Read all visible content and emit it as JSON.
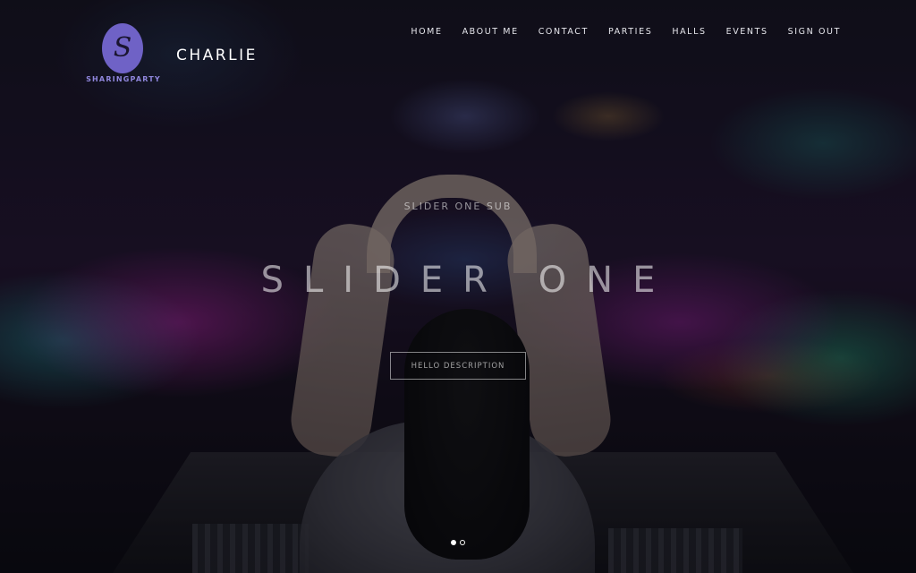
{
  "header": {
    "logo_text": "SHARINGPARTY",
    "logo_glyph": "S",
    "username": "CHARLIE"
  },
  "nav": {
    "items": [
      {
        "label": "HOME"
      },
      {
        "label": "ABOUT ME"
      },
      {
        "label": "CONTACT"
      },
      {
        "label": "PARTIES"
      },
      {
        "label": "HALLS"
      },
      {
        "label": "EVENTS"
      },
      {
        "label": "SIGN OUT"
      }
    ]
  },
  "slider": {
    "subtitle": "SLIDER ONE SUB",
    "title": "SLIDER ONE",
    "button_label": "HELLO DESCRIPTION",
    "active_slide": 1,
    "total_slides": 2
  },
  "colors": {
    "logo_accent": "#6f62c6",
    "logo_text": "#8f86dc"
  }
}
